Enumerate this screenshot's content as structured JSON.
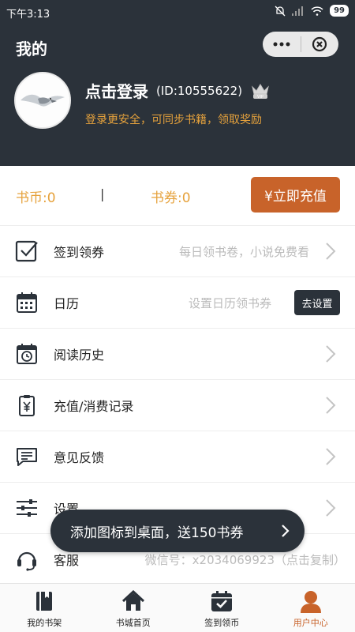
{
  "status": {
    "time": "下午3:13",
    "battery": "99"
  },
  "header": {
    "title": "我的"
  },
  "profile": {
    "login_text": "点击登录",
    "user_id": "(ID:10555622)",
    "vip_badge": "VIP",
    "subtitle": "登录更安全，可同步书籍，领取奖励"
  },
  "balance": {
    "coins": "书币:0",
    "separator": "|",
    "vouchers": "书券:0",
    "recharge_label": "¥立即充值"
  },
  "menu": [
    {
      "label": "签到领券",
      "hint": "每日领书卷，小说免费看",
      "icon": "checkbox-icon"
    },
    {
      "label": "日历",
      "hint": "设置日历领书券",
      "button": "去设置",
      "icon": "calendar-icon"
    },
    {
      "label": "阅读历史",
      "hint": "",
      "icon": "history-calendar-icon"
    },
    {
      "label": "充值/消费记录",
      "hint": "",
      "icon": "yuan-clipboard-icon"
    },
    {
      "label": "意见反馈",
      "hint": "",
      "icon": "feedback-message-icon"
    },
    {
      "label": "设置",
      "hint": "",
      "icon": "sliders-icon"
    },
    {
      "label": "客服",
      "hint": "微信号：x2034069923（点击复制）",
      "icon": "headset-icon"
    }
  ],
  "toast": {
    "text": "添加图标到桌面，送150书券"
  },
  "tabs": [
    {
      "label": "我的书架",
      "icon": "bookshelf-icon"
    },
    {
      "label": "书城首页",
      "icon": "home-icon"
    },
    {
      "label": "签到领币",
      "icon": "calendar-check-icon"
    },
    {
      "label": "用户中心",
      "icon": "user-icon",
      "active": true
    }
  ],
  "colors": {
    "header_bg": "#2b323a",
    "accent": "#c8632a",
    "gold": "#e6a23c"
  }
}
